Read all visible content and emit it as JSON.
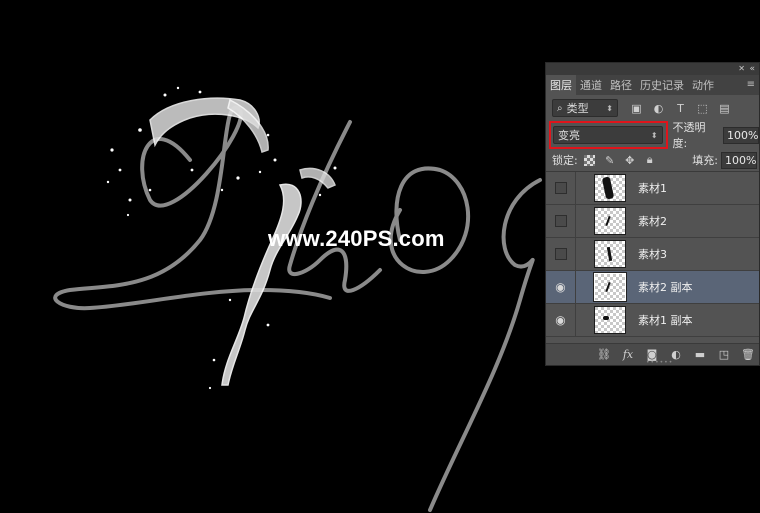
{
  "watermark": "www.240PS.com",
  "panel": {
    "tabs": [
      {
        "label": "图层",
        "active": true
      },
      {
        "label": "通道",
        "active": false
      },
      {
        "label": "路径",
        "active": false
      },
      {
        "label": "历史记录",
        "active": false
      },
      {
        "label": "动作",
        "active": false
      }
    ],
    "filter_kind": "类型",
    "blend_mode": "变亮",
    "opacity_label": "不透明度:",
    "opacity_value": "100%",
    "lock_label": "锁定:",
    "fill_label": "填充:",
    "fill_value": "100%",
    "layers": [
      {
        "name": "素材1",
        "visible": false,
        "selected": false
      },
      {
        "name": "素材2",
        "visible": false,
        "selected": false
      },
      {
        "name": "素材3",
        "visible": false,
        "selected": false
      },
      {
        "name": "素材2 副本",
        "visible": true,
        "selected": true
      },
      {
        "name": "素材1 副本",
        "visible": true,
        "selected": false
      }
    ]
  },
  "colors": {
    "canvas_bg": "#000000",
    "stroke_gray": "#8a8a8a",
    "selected_layer": "#5a6577",
    "highlight_red": "#e0141b"
  }
}
